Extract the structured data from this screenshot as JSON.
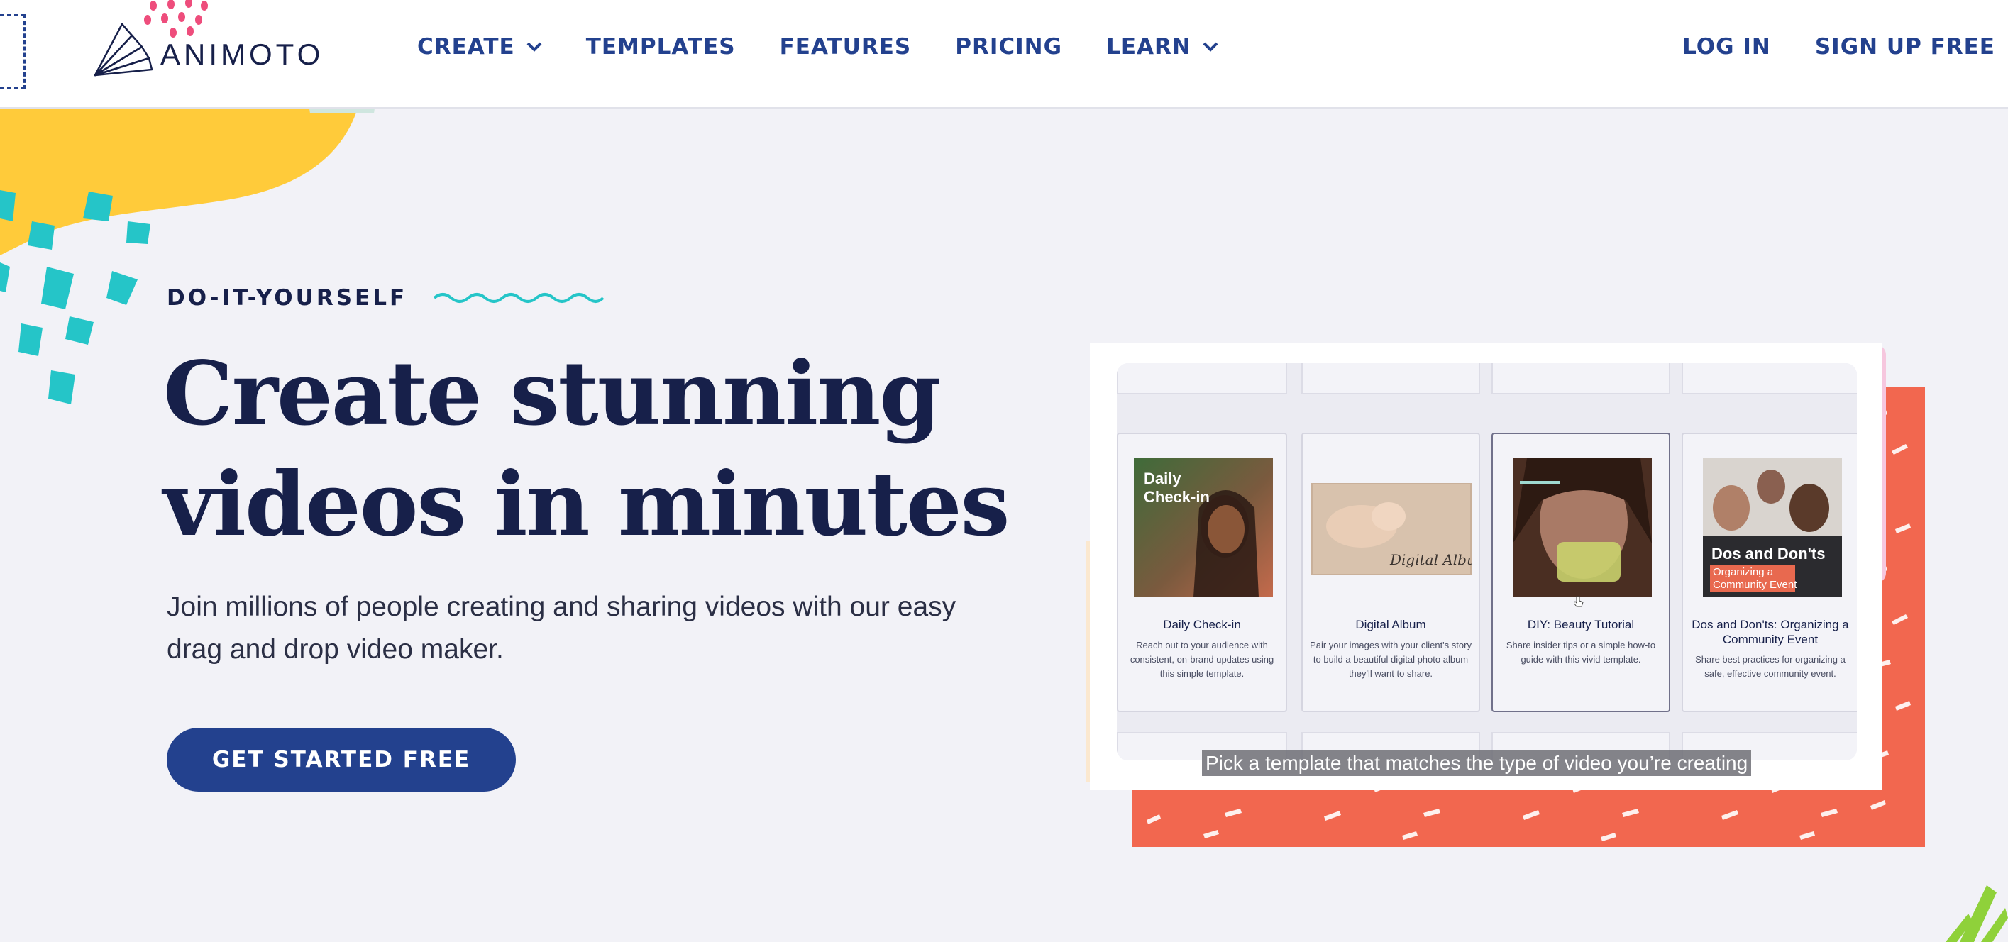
{
  "header": {
    "logo_text": "ANIMOTO",
    "nav": [
      {
        "label": "CREATE",
        "has_dropdown": true
      },
      {
        "label": "TEMPLATES",
        "has_dropdown": false
      },
      {
        "label": "FEATURES",
        "has_dropdown": false
      },
      {
        "label": "PRICING",
        "has_dropdown": false
      },
      {
        "label": "LEARN",
        "has_dropdown": true
      }
    ],
    "login_label": "LOG IN",
    "signup_label": "SIGN UP FREE"
  },
  "hero": {
    "eyebrow": "DO-IT-YOURSELF",
    "headline_line1": "Create stunning",
    "headline_line2": "videos in minutes",
    "subtext": "Join millions of people creating and sharing videos with our easy drag and drop video maker.",
    "cta_label": "GET STARTED FREE"
  },
  "demo": {
    "cards": [
      {
        "title": "Daily Check-in",
        "description": "Reach out to your audience with consistent, on-brand updates using this simple template.",
        "thumb_overlay": "Daily\nCheck-in"
      },
      {
        "title": "Digital Album",
        "description": "Pair your images with your client's story to build a beautiful digital photo album they'll want to share.",
        "thumb_overlay": "Digital Album"
      },
      {
        "title": "DIY: Beauty Tutorial",
        "description": "Share insider tips or a simple how-to guide with this vivid template.",
        "thumb_overlay": ""
      },
      {
        "title": "Dos and Don'ts: Organizing a Community Event",
        "description": "Share best practices for organizing a safe, effective community event.",
        "thumb_overlay": "Dos and Don'ts",
        "thumb_overlay_sub": "Organizing a Community Event"
      }
    ],
    "selected_card": 2,
    "caption": "Pick a template that matches the type of video you’re creating"
  },
  "colors": {
    "brand_navy": "#23418e",
    "text_dark": "#17204a",
    "accent_yellow": "#ffcb3a",
    "accent_teal": "#25c5c8",
    "accent_coral": "#f2674f",
    "accent_pink": "#f6c7de",
    "background": "#f2f2f7"
  }
}
